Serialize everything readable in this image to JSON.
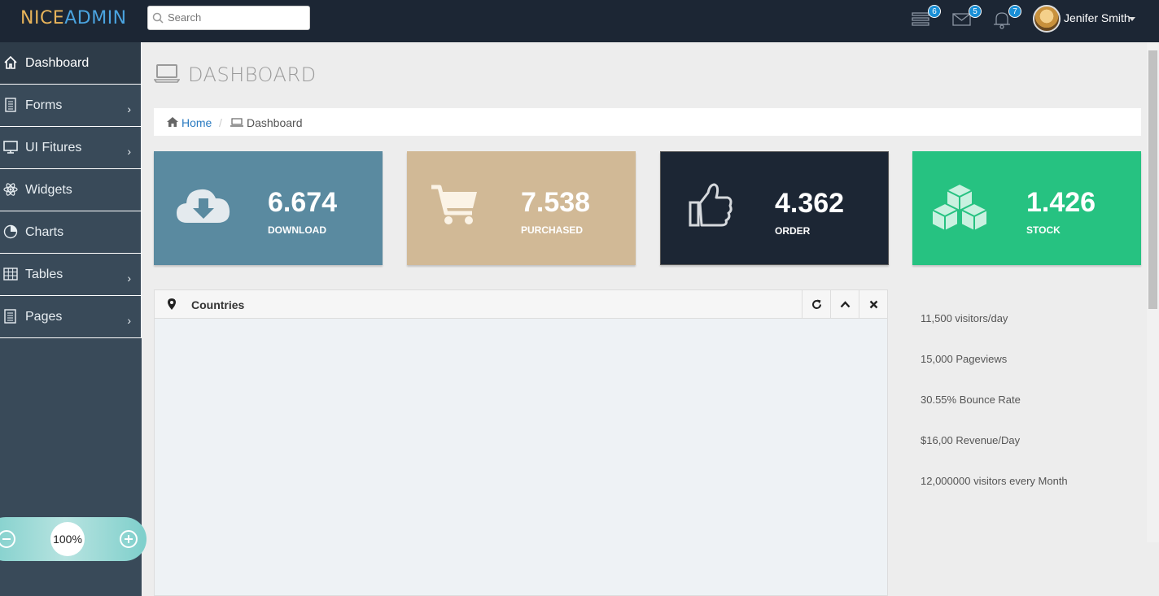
{
  "header": {
    "logo_part1": "NICE",
    "logo_part2": "ADMIN",
    "search_placeholder": "Search",
    "badges": {
      "tasks": "6",
      "mail": "5",
      "alerts": "7"
    },
    "user_name": "Jenifer Smith"
  },
  "sidebar": {
    "items": [
      {
        "label": "Dashboard",
        "icon": "home-icon",
        "active": true
      },
      {
        "label": "Forms",
        "icon": "document-icon",
        "arrow": "›"
      },
      {
        "label": "UI Fitures",
        "icon": "monitor-icon",
        "arrow": "›"
      },
      {
        "label": "Widgets",
        "icon": "atom-icon"
      },
      {
        "label": "Charts",
        "icon": "pie-chart-icon"
      },
      {
        "label": "Tables",
        "icon": "table-icon",
        "arrow": "›"
      },
      {
        "label": "Pages",
        "icon": "pages-icon",
        "arrow": "›"
      }
    ],
    "zoom_value": "100%"
  },
  "main": {
    "page_title": "DASHBOARD",
    "breadcrumb": {
      "home": "Home",
      "separator": "/",
      "current": "Dashboard"
    },
    "stats": [
      {
        "value": "6.674",
        "label": "DOWNLOAD",
        "color": "#5a8aa0",
        "icon": "cloud-download-icon"
      },
      {
        "value": "7.538",
        "label": "PURCHASED",
        "color": "#d1b996",
        "icon": "shopping-cart-icon"
      },
      {
        "value": "4.362",
        "label": "ORDER",
        "color": "#1c2634",
        "icon": "thumbs-up-icon"
      },
      {
        "value": "1.426",
        "label": "STOCK",
        "color": "#26c281",
        "icon": "cubes-icon"
      }
    ],
    "panel": {
      "title": "Countries"
    },
    "side_stats": [
      "11,500 visitors/day",
      "15,000 Pageviews",
      "30.55% Bounce Rate",
      "$16,00 Revenue/Day",
      "12,000000 visitors every Month"
    ]
  }
}
